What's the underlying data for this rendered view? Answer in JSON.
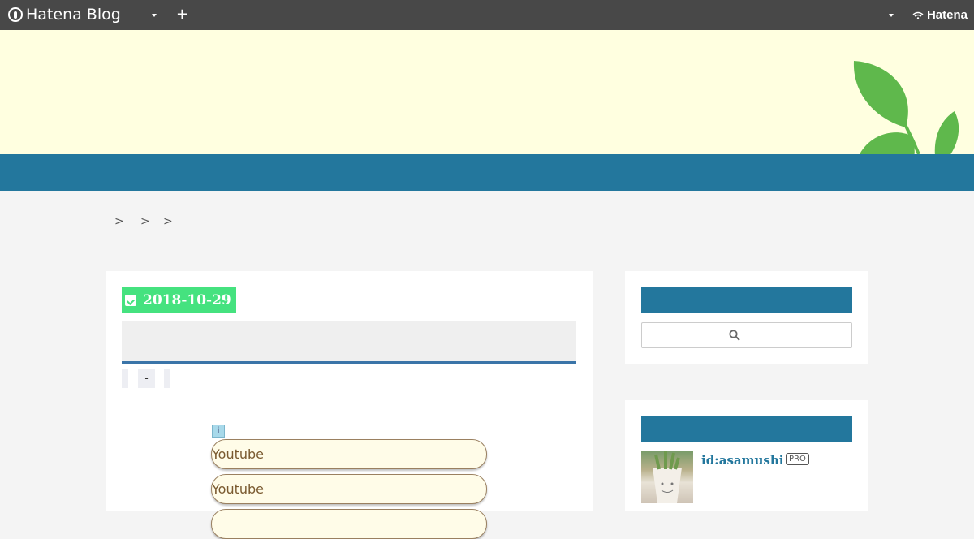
{
  "topbar": {
    "brand": "Hatena Blog",
    "brand_icon": "hatena-blog-logo-icon",
    "add_icon": "plus-icon",
    "account_brand": "Hatena"
  },
  "breadcrumb": {
    "separators": [
      ">",
      ">",
      ">"
    ]
  },
  "entry": {
    "date": "2018-10-29",
    "categories": [
      "",
      "-",
      ""
    ],
    "links": [
      "Youtube",
      "Youtube"
    ]
  },
  "sidebar": {
    "search_icon": "search-icon",
    "profile": {
      "id": "id:asamushi",
      "badge": "PRO"
    }
  },
  "colors": {
    "topbar": "#484848",
    "header_bg": "#ffffe0",
    "accent_blue": "#23779d",
    "date_green": "#45e27f",
    "leaf_green": "#5fb84c"
  }
}
